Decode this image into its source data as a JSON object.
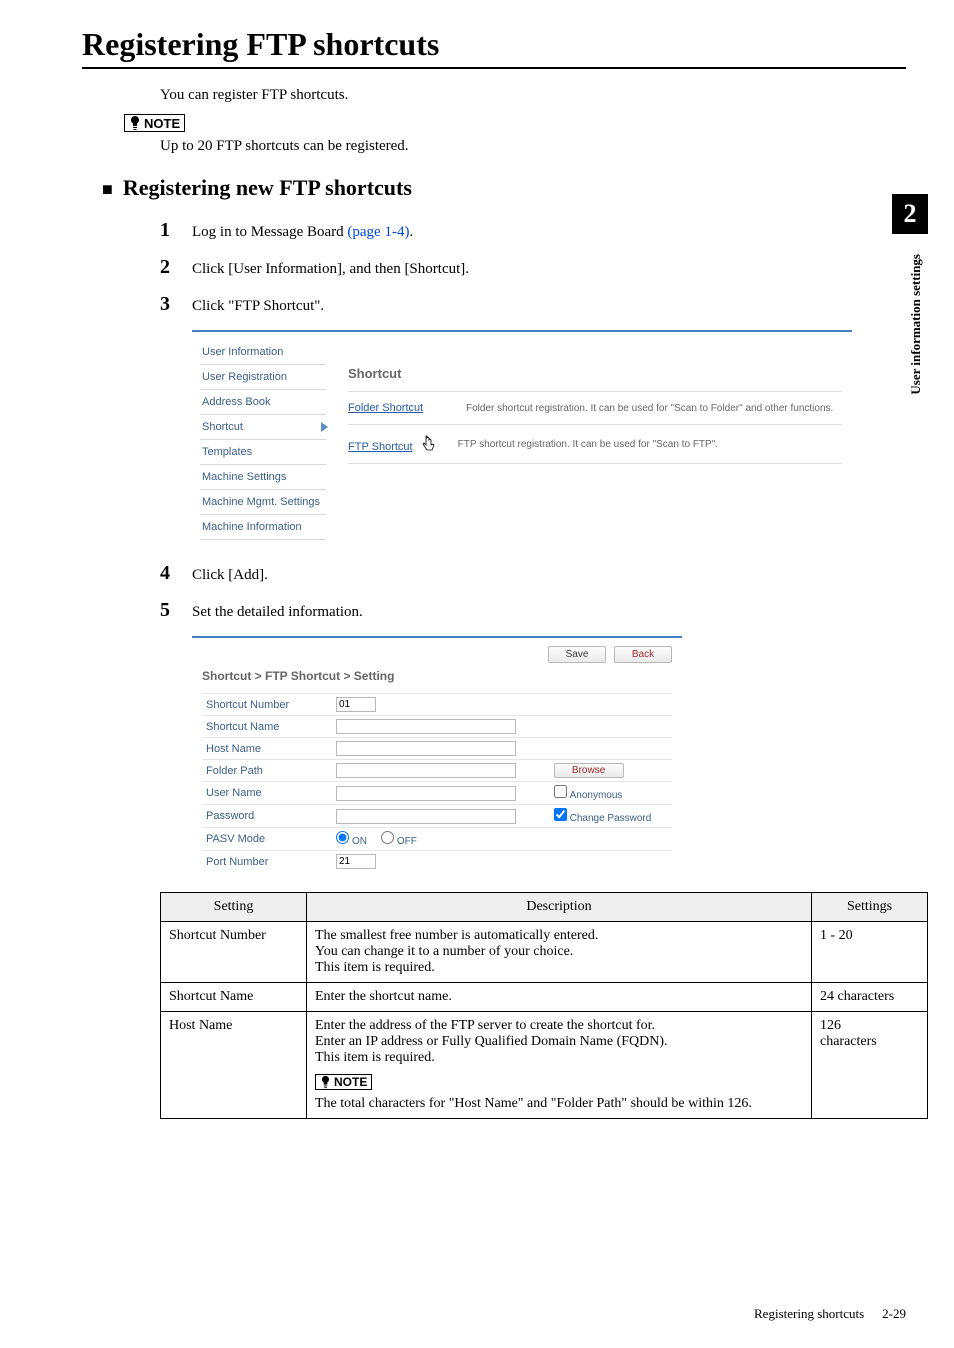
{
  "chapter_tab": "2",
  "side_label": "User information settings",
  "h1": "Registering FTP shortcuts",
  "intro": "You can register FTP shortcuts.",
  "note_label": "NOTE",
  "note_text": "Up to 20 FTP shortcuts can be registered.",
  "h2": "Registering new FTP shortcuts",
  "steps": {
    "s1_a": "Log in to Message Board ",
    "s1_link": "(page 1-4)",
    "s1_b": ".",
    "s2": "Click [User Information], and then [Shortcut].",
    "s3": "Click \"FTP Shortcut\".",
    "s4": "Click [Add].",
    "s5": "Set the detailed information."
  },
  "shot1": {
    "sidebar": {
      "items": [
        "User Information",
        "User Registration",
        "Address Book",
        "Shortcut",
        "Templates",
        "Machine Settings",
        "Machine Mgmt. Settings",
        "Machine Information"
      ]
    },
    "heading": "Shortcut",
    "rows": [
      {
        "link": "Folder Shortcut",
        "desc": "Folder shortcut registration. It can be used for \"Scan to Folder\" and other functions."
      },
      {
        "link": "FTP Shortcut",
        "desc": "FTP shortcut registration. It can be used for \"Scan to FTP\"."
      }
    ]
  },
  "shot2": {
    "save": "Save",
    "back": "Back",
    "heading": "Shortcut > FTP Shortcut > Setting",
    "fields": {
      "shortcut_number": {
        "label": "Shortcut Number",
        "value": "01"
      },
      "shortcut_name": {
        "label": "Shortcut Name",
        "value": ""
      },
      "host_name": {
        "label": "Host Name",
        "value": ""
      },
      "folder_path": {
        "label": "Folder Path",
        "value": "",
        "browse": "Browse"
      },
      "user_name": {
        "label": "User Name",
        "value": "",
        "anon": "Anonymous"
      },
      "password": {
        "label": "Password",
        "value": "",
        "change": "Change Password"
      },
      "pasv": {
        "label": "PASV Mode",
        "on": "ON",
        "off": "OFF"
      },
      "port": {
        "label": "Port Number",
        "value": "21"
      }
    }
  },
  "table": {
    "headers": {
      "setting": "Setting",
      "description": "Description",
      "settings": "Settings"
    },
    "rows": [
      {
        "setting": "Shortcut Number",
        "description": "The smallest free number is automatically entered. You can change it to a number for your choice. This item is required.",
        "settings": "1 - 20"
      },
      {
        "setting": "Shortcut Name",
        "description": "Enter the shortcut name.",
        "settings": "24 characters"
      },
      {
        "setting": "Host Name",
        "description_main": "Enter the address of the FTP server to create the shortcut for.\nEnter an IP address or Fully Qualified Domain Name (FQDN).\nThis item is required.",
        "note_label": "NOTE",
        "description_note": "The total characters for \"Host Name\" and \"Folder Path\" should be within 126.",
        "settings": "126 characters"
      }
    ]
  },
  "footer": {
    "title": "Registering shortcuts",
    "page": "2-29"
  }
}
